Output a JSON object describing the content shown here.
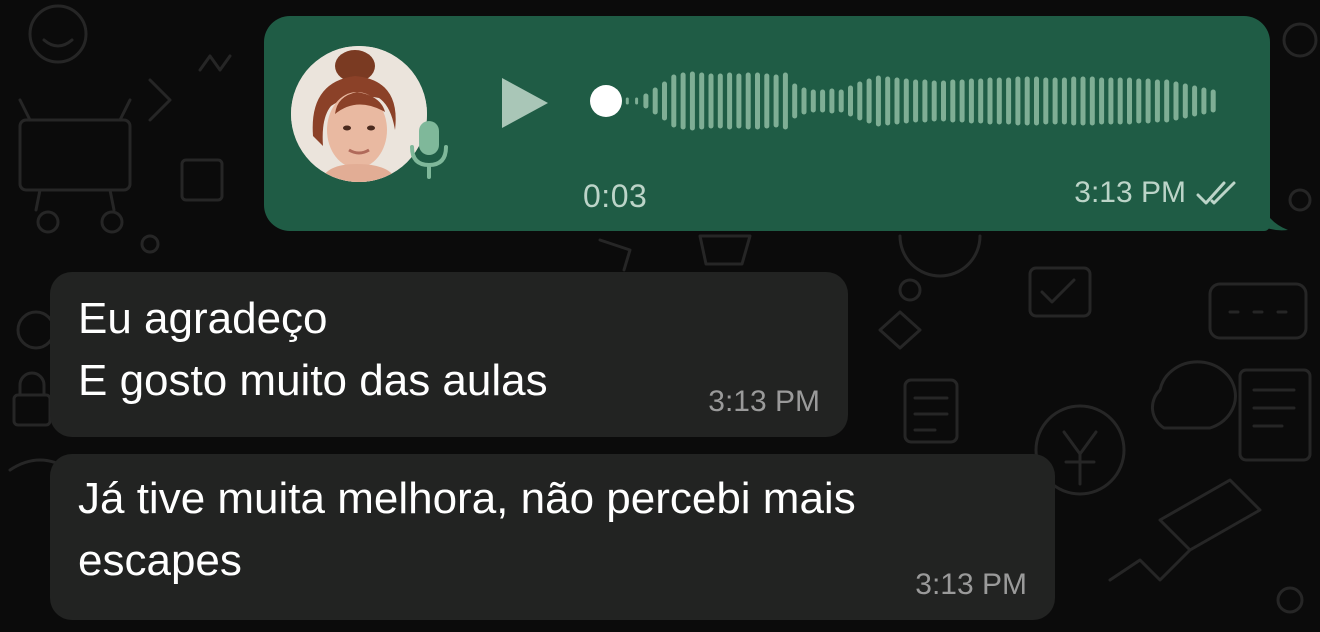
{
  "voice_message": {
    "duration": "0:03",
    "time": "3:13 PM",
    "status": "read",
    "play_icon": "play-icon",
    "mic_icon": "microphone-icon",
    "progress": 0.0
  },
  "messages": [
    {
      "lines": [
        "Eu agradeço",
        "E gosto muito das aulas"
      ],
      "time": "3:13 PM"
    },
    {
      "lines": [
        "Já tive muita melhora, não percebi mais",
        "escapes"
      ],
      "time": "3:13 PM"
    }
  ],
  "colors": {
    "background": "#0b0b0b",
    "outgoing_bubble": "#1f5c45",
    "incoming_bubble": "#222322",
    "meta_text_out": "#bcd4c8",
    "meta_text_in": "#9a9a9a"
  }
}
